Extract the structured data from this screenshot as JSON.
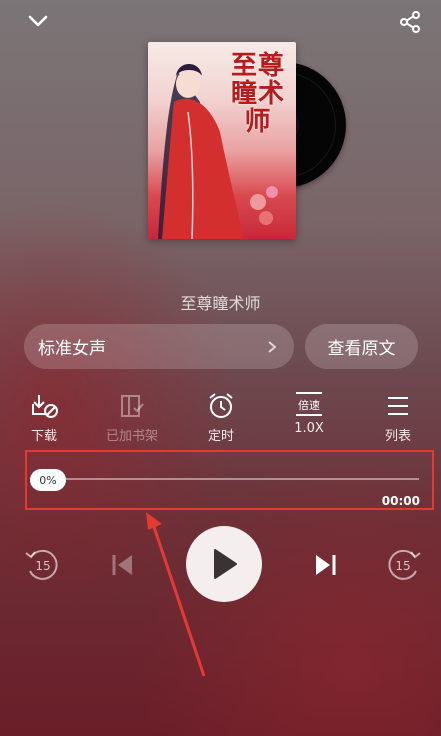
{
  "player": {
    "book_title": "至尊瞳术师",
    "cover_title": "至尊瞳术师",
    "progress_fraction": 0
  },
  "voice": {
    "label": "标准女声"
  },
  "original": {
    "label": "查看原文"
  },
  "actions": {
    "download": "下载",
    "added_shelf": "已加书架",
    "timer": "定时",
    "speed_badge": "倍速",
    "speed": "1.0X",
    "list": "列表"
  },
  "progress": {
    "percent": "0%",
    "time": "00:00"
  },
  "controls": {
    "rewind_seconds": "15",
    "forward_seconds": "15"
  },
  "colors": {
    "highlight": "#e53935",
    "arrow": "#e53935"
  },
  "icons": [
    "chevron-down-icon",
    "share-icon",
    "download-icon",
    "bookshelf-icon",
    "alarm-clock-icon",
    "speed-icon",
    "list-icon",
    "rewind-15-icon",
    "previous-icon",
    "play-icon",
    "next-icon",
    "forward-15-icon"
  ]
}
